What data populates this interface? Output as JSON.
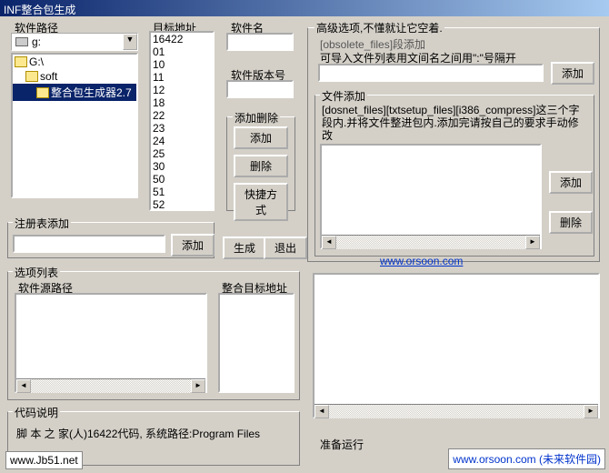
{
  "title": "INF整合包生成",
  "labels": {
    "software_path": "软件路径",
    "target_address": "目标地址",
    "software_name": "软件名",
    "software_version": "软件版本号",
    "add_delete": "添加删除",
    "advanced_options": "高级选项,不懂就让它空着.",
    "obsolete_hint": "[obsolete_files]段添加",
    "obsolete_desc": "可导入文件列表用文间名之间用\":\"号隔开",
    "file_add": "文件添加",
    "file_add_desc": "[dosnet_files][txtsetup_files][i386_compress]这三个字段内.并将文件整进包内.添加完请按自己的要求手动修改",
    "registry_add": "注册表添加",
    "option_list": "选项列表",
    "source_path": "软件源路径",
    "integrated_target": "整合目标地址",
    "code_desc": "代码说明",
    "code_text": "脚 本 之 家(人)16422代码, 系统路径:Program Files",
    "ready": "准备运行"
  },
  "buttons": {
    "add": "添加",
    "delete": "删除",
    "shortcut": "快捷方式",
    "generate": "生成",
    "exit": "退出"
  },
  "drive": "g:",
  "tree": [
    "G:\\",
    "soft",
    "整合包生成器2.7"
  ],
  "dirlist": [
    "16422",
    "01",
    "10",
    "11",
    "12",
    "18",
    "22",
    "23",
    "24",
    "25",
    "30",
    "50",
    "51",
    "52"
  ],
  "links": {
    "orsoon": "www.orsoon.com",
    "jb51": "www.Jb51.net",
    "footer": "www.orsoon.com (未来软件园)"
  }
}
